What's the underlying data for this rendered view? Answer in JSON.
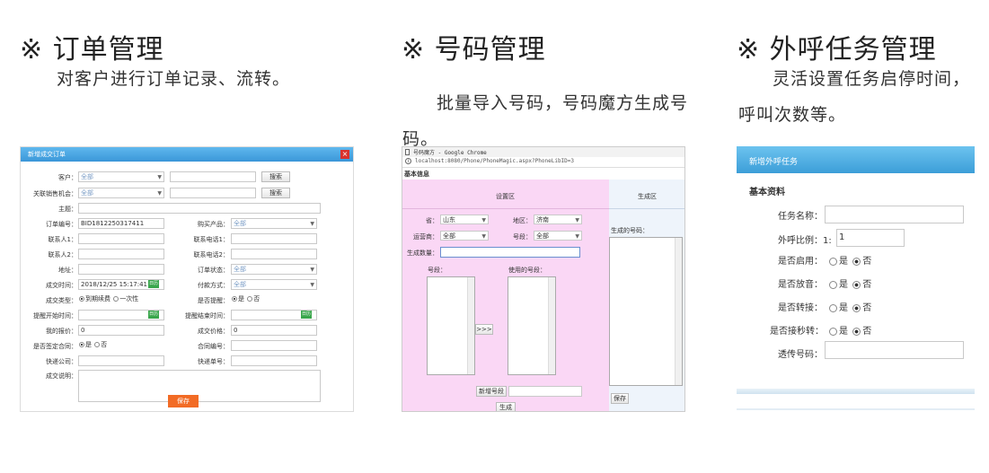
{
  "sections": [
    {
      "title": "※ 订单管理",
      "desc": "对客户进行订单记录、流转。"
    },
    {
      "title": "※ 号码管理",
      "desc": "批量导入号码，号码魔方生成号码。"
    },
    {
      "title": "※ 外呼任务管理",
      "desc": "灵活设置任务启停时间，呼叫次数等。"
    }
  ],
  "order_dialog": {
    "title": "新增成交订单",
    "close": "×",
    "customer_label": "客户：",
    "customer_value": "全部",
    "search1": "搜索",
    "opportunity_label": "关联销售机会：",
    "opportunity_value": "全部",
    "search2": "搜索",
    "subject_label": "主题：",
    "order_no_label": "订单编号：",
    "order_no_value": "BID1812250317411",
    "product_label": "购买产品：",
    "product_value": "全部",
    "contact1_label": "联系人1：",
    "phone1_label": "联系电话1：",
    "contact2_label": "联系人2：",
    "phone2_label": "联系电话2：",
    "address_label": "地址：",
    "status_label": "订单状态：",
    "status_value": "全部",
    "deal_time_label": "成交时间：",
    "deal_time_value": "2018/12/25 15:17:41",
    "cal": "日历",
    "pay_label": "付款方式：",
    "pay_value": "全部",
    "deal_type_label": "成交类型：",
    "deal_type_opt1": "到期续费",
    "deal_type_opt2": "一次性",
    "remind_label": "是否提醒：",
    "yes": "是",
    "no": "否",
    "remind_start_label": "提醒开始时间：",
    "remind_end_label": "提醒结束时间：",
    "quote_label": "我的报价：",
    "quote_value": "0",
    "deal_price_label": "成交价格：",
    "deal_price_value": "0",
    "contract_label": "是否签定合同：",
    "contract_no_label": "合同编号：",
    "express_label": "快递公司：",
    "express_no_label": "快递单号：",
    "remark_label": "成交说明：",
    "save": "保存"
  },
  "number_magic": {
    "window_title": "号码魔方 - Google Chrome",
    "url": "localhost:8080/Phone/PhoneMagic.aspx?PhoneLibID=3",
    "section": "基本信息",
    "setting_area": "设置区",
    "generate_area": "生成区",
    "province_label": "省：",
    "province_value": "山东",
    "city_label": "地区：",
    "city_value": "济南",
    "carrier_label": "运营商：",
    "carrier_value": "全部",
    "segment_label": "号段：",
    "segment_value": "全部",
    "count_label": "生成数量：",
    "seg_list_label": "号段：",
    "used_seg_label": "使用的号段：",
    "move": ">>>",
    "generated_label": "生成的号码：",
    "add_seg": "新增号段",
    "generate": "生成",
    "save": "保存"
  },
  "outbound_task": {
    "title": "新增外呼任务",
    "section": "基本资料",
    "name_label": "任务名称：",
    "ratio_label": "外呼比例：1:",
    "ratio_value": "1",
    "enable_label": "是否启用：",
    "recording_label": "是否放音：",
    "transfer_label": "是否转接：",
    "seconds_label": "是否接秒转：",
    "relay_label": "透传号码：",
    "yes": "是",
    "no": "否"
  }
}
